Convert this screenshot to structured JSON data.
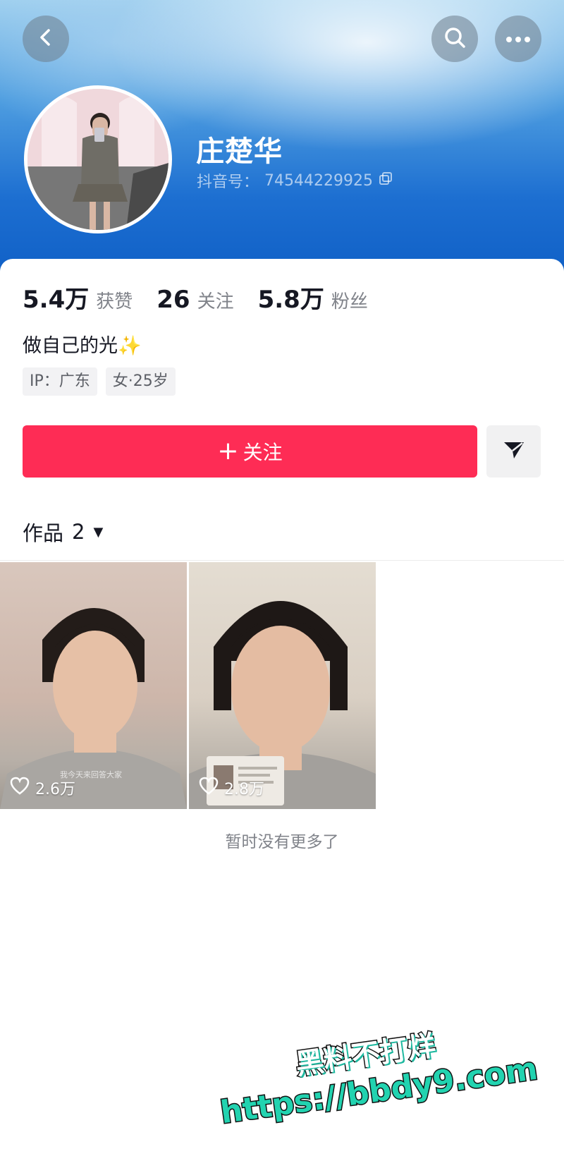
{
  "header": {
    "icons": {
      "back": "chevron-left-icon",
      "search": "search-icon",
      "more": "more-dots-icon"
    }
  },
  "profile": {
    "name": "庄楚华",
    "id_label": "抖音号：",
    "id_value": "74544229925",
    "copy_icon": "copy-icon",
    "avatar_icon": "avatar-photo"
  },
  "stats": [
    {
      "value": "5.4万",
      "label": "获赞"
    },
    {
      "value": "26",
      "label": "关注"
    },
    {
      "value": "5.8万",
      "label": "粉丝"
    }
  ],
  "bio": "做自己的光✨",
  "tags": [
    "IP：广东",
    "女·25岁"
  ],
  "actions": {
    "follow_plus": "+",
    "follow_label": "关注",
    "share_icon": "send-icon"
  },
  "works": {
    "label": "作品",
    "count": "2",
    "caret": "▼",
    "items": [
      {
        "likes": "2.6万",
        "caption": "我今天来回答大家"
      },
      {
        "likes": "2.8万"
      }
    ]
  },
  "footer": {
    "no_more": "暂时没有更多了"
  },
  "watermark": {
    "line1": "黑料不打烊",
    "line2": "https://bbdy9.com"
  },
  "colors": {
    "accent": "#fe2c55",
    "header_blue": "#1d6fd1",
    "text_primary": "#161823",
    "text_secondary": "#80838a"
  }
}
